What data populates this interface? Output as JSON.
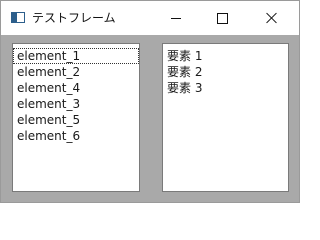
{
  "window": {
    "title": "テストフレーム",
    "icon": "app-window-icon",
    "controls": [
      "minimize-icon",
      "maximize-icon",
      "close-icon"
    ]
  },
  "left_list": {
    "items": [
      "element_1",
      "element_2",
      "element_4",
      "element_3",
      "element_5",
      "element_6"
    ],
    "focused_index": 0
  },
  "right_list": {
    "items": [
      "要素 1",
      "要素 2",
      "要素 3"
    ]
  },
  "colors": {
    "titlebar": "#ffffff",
    "client_area": "#a9a9a9",
    "list_background": "#ffffff",
    "list_border": "#7a7a7a"
  }
}
